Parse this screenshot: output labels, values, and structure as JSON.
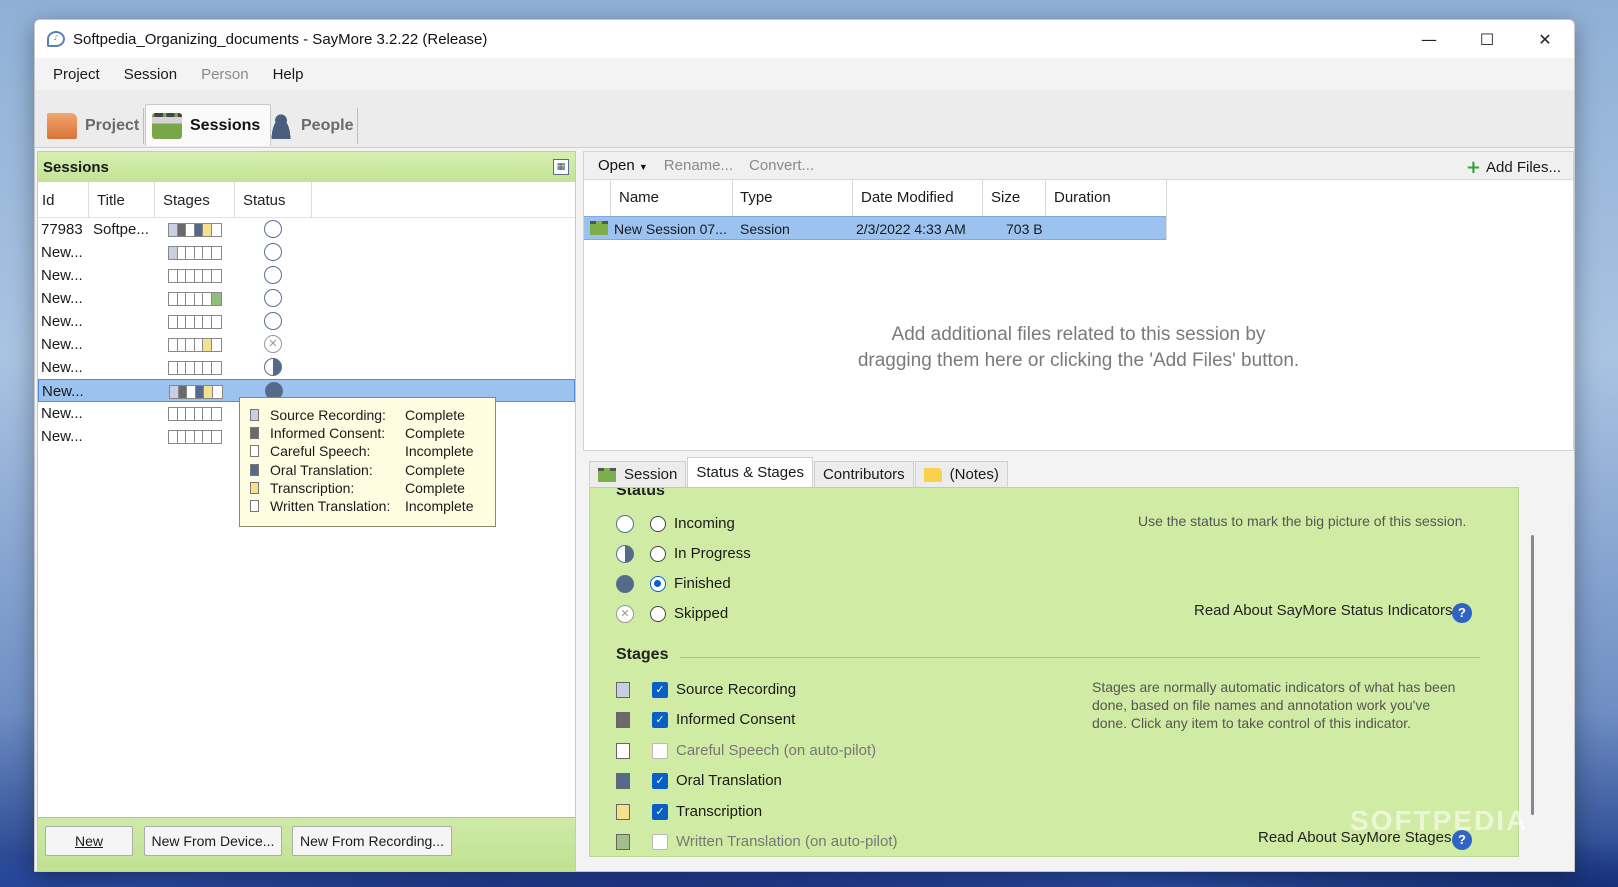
{
  "window": {
    "title": "Softpedia_Organizing_documents - SayMore 3.2.22 (Release)",
    "controls": [
      "minimize",
      "maximize",
      "close"
    ]
  },
  "menubar": {
    "items": [
      {
        "label": "Project",
        "enabled": true
      },
      {
        "label": "Session",
        "enabled": true
      },
      {
        "label": "Person",
        "enabled": false
      },
      {
        "label": "Help",
        "enabled": true
      }
    ]
  },
  "main_tabs": [
    {
      "label": "Project",
      "icon": "folder-icon",
      "active": false
    },
    {
      "label": "Sessions",
      "icon": "clapperboard-icon",
      "active": true
    },
    {
      "label": "People",
      "icon": "person-icon",
      "active": false
    }
  ],
  "sessions_panel": {
    "header": "Sessions",
    "columns": [
      "Id",
      "Title",
      "Stages",
      "Status"
    ],
    "rows": [
      {
        "id": "77983",
        "title": "Softpe...",
        "stages": [
          "#c8cfe0",
          "#6a6a6a",
          "#ffffff",
          "#556a8a",
          "#f6e08c",
          "#ffffff"
        ],
        "status": "incoming"
      },
      {
        "id": "New...",
        "title": "",
        "stages": [
          "#c8cfe0",
          "#ffffff",
          "#ffffff",
          "#ffffff",
          "#ffffff",
          "#ffffff"
        ],
        "status": "incoming"
      },
      {
        "id": "New...",
        "title": "",
        "stages": [
          "#ffffff",
          "#ffffff",
          "#ffffff",
          "#ffffff",
          "#ffffff",
          "#ffffff"
        ],
        "status": "incoming"
      },
      {
        "id": "New...",
        "title": "",
        "stages": [
          "#ffffff",
          "#ffffff",
          "#ffffff",
          "#ffffff",
          "#ffffff",
          "#8fbf7a"
        ],
        "status": "incoming"
      },
      {
        "id": "New...",
        "title": "",
        "stages": [
          "#ffffff",
          "#ffffff",
          "#ffffff",
          "#ffffff",
          "#ffffff",
          "#ffffff"
        ],
        "status": "incoming"
      },
      {
        "id": "New...",
        "title": "",
        "stages": [
          "#ffffff",
          "#ffffff",
          "#ffffff",
          "#ffffff",
          "#f6e08c",
          "#ffffff"
        ],
        "status": "skipped"
      },
      {
        "id": "New...",
        "title": "",
        "stages": [
          "#ffffff",
          "#ffffff",
          "#ffffff",
          "#ffffff",
          "#ffffff",
          "#ffffff"
        ],
        "status": "inprogress"
      },
      {
        "id": "New...",
        "title": "",
        "stages": [
          "#c8cfe0",
          "#6a6a6a",
          "#ffffff",
          "#556a8a",
          "#f6e08c",
          "#ffffff"
        ],
        "status": "finished",
        "selected": true
      },
      {
        "id": "New...",
        "title": "",
        "stages": [
          "#ffffff",
          "#ffffff",
          "#ffffff",
          "#ffffff",
          "#ffffff",
          "#ffffff"
        ],
        "status": ""
      },
      {
        "id": "New...",
        "title": "",
        "stages": [
          "#ffffff",
          "#ffffff",
          "#ffffff",
          "#ffffff",
          "#ffffff",
          "#ffffff"
        ],
        "status": ""
      }
    ],
    "tooltip": [
      {
        "label": "Source Recording:",
        "value": "Complete",
        "color": "#c8cfe0"
      },
      {
        "label": "Informed Consent:",
        "value": "Complete",
        "color": "#6a6a6a"
      },
      {
        "label": "Careful Speech:",
        "value": "Incomplete",
        "color": "#ffffff"
      },
      {
        "label": "Oral Translation:",
        "value": "Complete",
        "color": "#556a8a"
      },
      {
        "label": "Transcription:",
        "value": "Complete",
        "color": "#f6e08c"
      },
      {
        "label": "Written Translation:",
        "value": "Incomplete",
        "color": "#ffffff"
      }
    ],
    "buttons": {
      "new": "New",
      "new_from_device": "New From Device...",
      "new_from_recording": "New From Recording..."
    }
  },
  "files_panel": {
    "toolbar": {
      "open": "Open",
      "rename": "Rename...",
      "convert": "Convert...",
      "add_files": "Add Files..."
    },
    "columns": [
      "Name",
      "Type",
      "Date Modified",
      "Size",
      "Duration"
    ],
    "rows": [
      {
        "name": "New Session 07...",
        "type": "Session",
        "date_modified": "2/3/2022 4:33 AM",
        "size": "703 B",
        "duration": ""
      }
    ],
    "drop_hint_line1": "Add additional files related to this session by",
    "drop_hint_line2": "dragging them here or clicking the 'Add Files' button."
  },
  "detail_tabs": [
    {
      "label": "Session",
      "active": false
    },
    {
      "label": "Status & Stages",
      "active": true
    },
    {
      "label": "Contributors",
      "active": false
    },
    {
      "label": "(Notes)",
      "active": false
    }
  ],
  "status_section": {
    "title": "Status",
    "options": [
      {
        "label": "Incoming",
        "icon": "incoming",
        "checked": false
      },
      {
        "label": "In Progress",
        "icon": "inprogress",
        "checked": false
      },
      {
        "label": "Finished",
        "icon": "finished",
        "checked": true
      },
      {
        "label": "Skipped",
        "icon": "skipped",
        "checked": false
      }
    ],
    "hint": "Use the status to mark the big picture of this session.",
    "link": "Read About SayMore Status Indicators"
  },
  "stages_section": {
    "title": "Stages",
    "items": [
      {
        "label": "Source Recording",
        "checked": true,
        "disabled": false,
        "color": "#c8cfe0"
      },
      {
        "label": "Informed Consent",
        "checked": true,
        "disabled": false,
        "color": "#6a6a6a"
      },
      {
        "label": "Careful Speech (on auto-pilot)",
        "checked": false,
        "disabled": true,
        "color": "#ffffff"
      },
      {
        "label": "Oral Translation",
        "checked": true,
        "disabled": false,
        "color": "#556a8a"
      },
      {
        "label": "Transcription",
        "checked": true,
        "disabled": false,
        "color": "#f6e08c"
      },
      {
        "label": "Written Translation (on auto-pilot)",
        "checked": false,
        "disabled": true,
        "color": "#9fc08a"
      }
    ],
    "hint_line1": "Stages are normally automatic indicators of what  has been",
    "hint_line2": "done, based on file names and annotation work you've",
    "hint_line3": "done. Click any item to take control of this indicator.",
    "link": "Read About SayMore Stages"
  },
  "watermark": "SOFTPEDIA"
}
